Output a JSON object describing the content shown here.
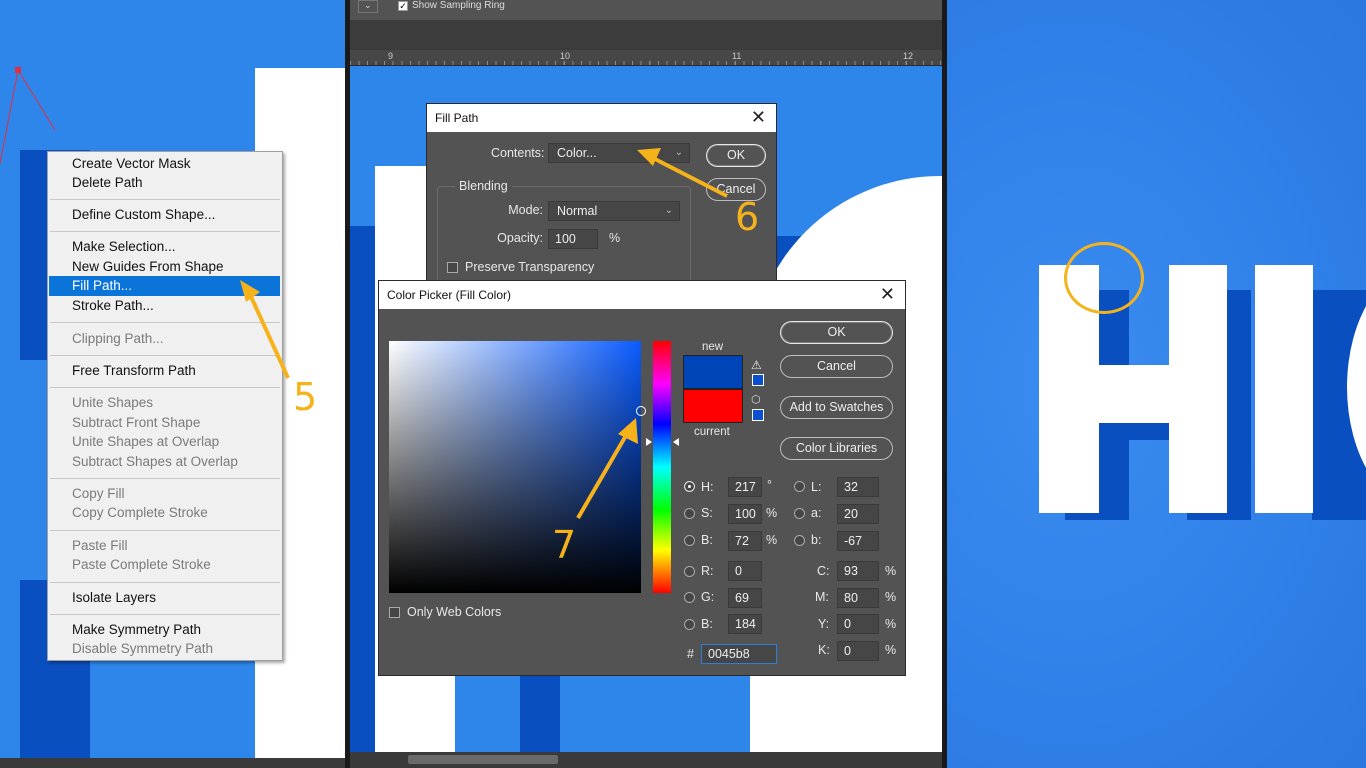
{
  "context_menu": {
    "items": [
      {
        "label": "Create Vector Mask",
        "state": "enabled"
      },
      {
        "label": "Delete Path",
        "state": "enabled"
      },
      {
        "label": "Define Custom Shape...",
        "state": "enabled"
      },
      {
        "label": "Make Selection...",
        "state": "enabled"
      },
      {
        "label": "New Guides From Shape",
        "state": "enabled"
      },
      {
        "label": "Fill Path...",
        "state": "selected"
      },
      {
        "label": "Stroke Path...",
        "state": "enabled"
      },
      {
        "label": "Clipping Path...",
        "state": "disabled"
      },
      {
        "label": "Free Transform Path",
        "state": "enabled"
      },
      {
        "label": "Unite Shapes",
        "state": "disabled"
      },
      {
        "label": "Subtract Front Shape",
        "state": "disabled"
      },
      {
        "label": "Unite Shapes at Overlap",
        "state": "disabled"
      },
      {
        "label": "Subtract Shapes at Overlap",
        "state": "disabled"
      },
      {
        "label": "Copy Fill",
        "state": "disabled"
      },
      {
        "label": "Copy Complete Stroke",
        "state": "disabled"
      },
      {
        "label": "Paste Fill",
        "state": "disabled"
      },
      {
        "label": "Paste Complete Stroke",
        "state": "disabled"
      },
      {
        "label": "Isolate Layers",
        "state": "enabled"
      },
      {
        "label": "Make Symmetry Path",
        "state": "enabled"
      },
      {
        "label": "Disable Symmetry Path",
        "state": "disabled"
      }
    ]
  },
  "annotations": {
    "step5": "5",
    "step6": "6",
    "step7": "7",
    "color": "#f6b21b"
  },
  "options_bar": {
    "show_sampling_ring": "Show Sampling Ring"
  },
  "ruler": {
    "ticks": [
      "9",
      "10",
      "11",
      "12"
    ]
  },
  "fill_path_dialog": {
    "title": "Fill Path",
    "contents_label": "Contents:",
    "contents_value": "Color...",
    "ok": "OK",
    "cancel": "Cancel",
    "blending_label": "Blending",
    "mode_label": "Mode:",
    "mode_value": "Normal",
    "opacity_label": "Opacity:",
    "opacity_value": "100",
    "opacity_unit": "%",
    "preserve_transparency": "Preserve Transparency"
  },
  "color_picker": {
    "title": "Color Picker (Fill Color)",
    "ok": "OK",
    "cancel": "Cancel",
    "add_to_swatches": "Add to Swatches",
    "color_libraries": "Color Libraries",
    "new_label": "new",
    "current_label": "current",
    "new_color": "#0045b8",
    "current_color": "#ff0000",
    "only_web_colors": "Only Web Colors",
    "hsb": [
      {
        "label": "H:",
        "value": "217",
        "unit": "°",
        "checked": true
      },
      {
        "label": "S:",
        "value": "100",
        "unit": "%",
        "checked": false
      },
      {
        "label": "B:",
        "value": "72",
        "unit": "%",
        "checked": false
      }
    ],
    "rgb": [
      {
        "label": "R:",
        "value": "0"
      },
      {
        "label": "G:",
        "value": "69"
      },
      {
        "label": "B:",
        "value": "184"
      }
    ],
    "lab": [
      {
        "label": "L:",
        "value": "32"
      },
      {
        "label": "a:",
        "value": "20"
      },
      {
        "label": "b:",
        "value": "-67"
      }
    ],
    "cmyk": [
      {
        "label": "C:",
        "value": "93",
        "unit": "%"
      },
      {
        "label": "M:",
        "value": "80",
        "unit": "%"
      },
      {
        "label": "Y:",
        "value": "0",
        "unit": "%"
      },
      {
        "label": "K:",
        "value": "0",
        "unit": "%"
      }
    ],
    "hex_label": "#",
    "hex_value": "0045b8"
  },
  "result": {
    "text": "HI"
  }
}
